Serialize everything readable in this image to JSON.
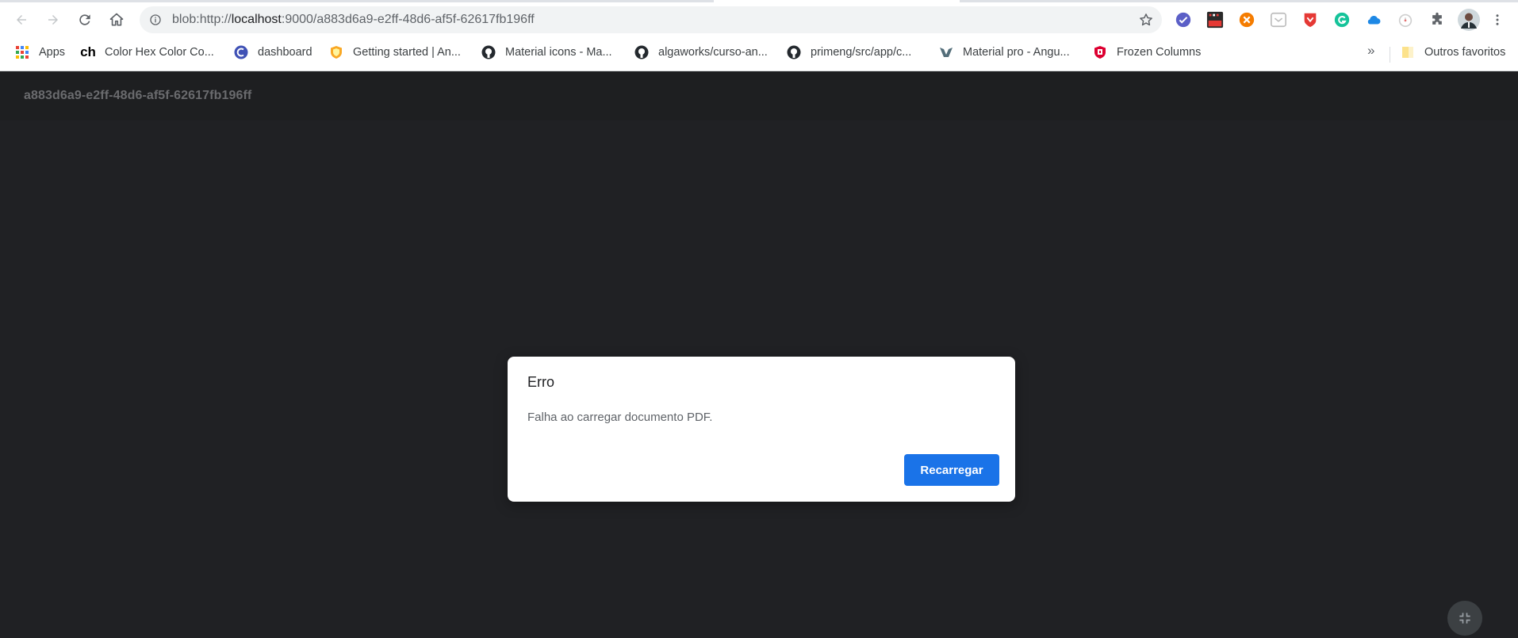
{
  "browser": {
    "url_scheme": "blob:http://",
    "url_host": "localhost",
    "url_rest": ":9000/a883d6a9-e2ff-48d6-af5f-62617fb196ff",
    "icons": {
      "back": "back-arrow-icon",
      "forward": "forward-arrow-icon",
      "reload": "reload-icon",
      "home": "home-icon",
      "site_info": "info-icon",
      "bookmark_star": "star-icon",
      "extensions": "puzzle-icon",
      "menu": "kebab-menu-icon"
    }
  },
  "bookmarks": {
    "items": [
      {
        "label": "Apps",
        "icon": "apps-grid-icon"
      },
      {
        "label": "Color Hex Color Co...",
        "icon": "ch-logo-icon",
        "badge": "ch"
      },
      {
        "label": "dashboard",
        "icon": "dashboard-logo-icon"
      },
      {
        "label": "Getting started | An...",
        "icon": "shield-logo-icon"
      },
      {
        "label": "Material icons - Ma...",
        "icon": "github-icon"
      },
      {
        "label": "algaworks/curso-an...",
        "icon": "github-icon"
      },
      {
        "label": "primeng/src/app/c...",
        "icon": "github-icon"
      },
      {
        "label": "Material pro - Angu...",
        "icon": "wrappixel-logo-icon"
      },
      {
        "label": "Frozen Columns",
        "icon": "primeng-logo-icon"
      }
    ],
    "overflow": "»",
    "other_folder": "Outros favoritos"
  },
  "viewer": {
    "title": "a883d6a9-e2ff-48d6-af5f-62617fb196ff"
  },
  "dialog": {
    "title": "Erro",
    "message": "Falha ao carregar documento PDF.",
    "button": "Recarregar"
  },
  "colors": {
    "viewer_bg": "#202124",
    "viewer_toolbar": "#1e1f21",
    "accent": "#1a73e8"
  }
}
